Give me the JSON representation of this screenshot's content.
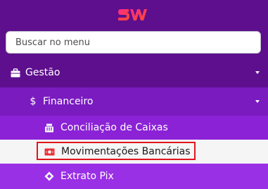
{
  "logo": {
    "text": "SW",
    "colors": [
      "#ff2a7a",
      "#ff4b2b"
    ]
  },
  "search": {
    "placeholder": "Buscar no menu",
    "value": ""
  },
  "menu": {
    "gestao": {
      "label": "Gestão",
      "icon": "briefcase-icon",
      "expanded": true
    },
    "financeiro": {
      "label": "Financeiro",
      "icon": "dollar-icon",
      "expanded": true
    },
    "conciliacao": {
      "label": "Conciliação de Caixas",
      "icon": "cash-register-icon"
    },
    "movimentacoes": {
      "label": "Movimentações Bancárias",
      "icon": "money-bill-icon",
      "selected": true
    },
    "extrato": {
      "label": "Extrato Pix",
      "icon": "pix-icon"
    }
  },
  "colors": {
    "sidebar_bg": "#5e0f8d",
    "level1_bg": "#7a1bc0",
    "level2_bg": "#8b22d6",
    "selected_bg": "#f5f5f5",
    "highlight": "#e0161d",
    "icon_red": "#e8343c"
  }
}
